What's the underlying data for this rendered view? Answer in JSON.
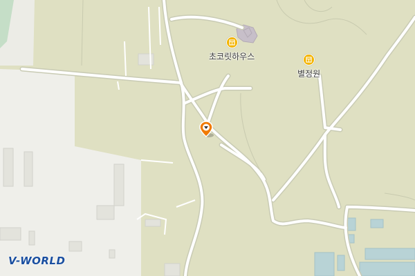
{
  "map": {
    "colors": {
      "land": "#dfe0c2",
      "urban": "#efefea",
      "road": "#ffffff",
      "road_outline": "#c9cbb4",
      "building": "#c5c6c0",
      "water_structure": "#a9c9d2",
      "poi_icon": "#f3b400",
      "marker": "#f07a00",
      "logo": "#1a4fa0"
    },
    "pois": [
      {
        "label": "초코릿하우스",
        "icon": "building-icon"
      },
      {
        "label": "별정원",
        "icon": "building-icon"
      }
    ],
    "marker": {
      "icon": "location-pin-icon"
    },
    "logo": {
      "text": "V-WORLD"
    }
  }
}
